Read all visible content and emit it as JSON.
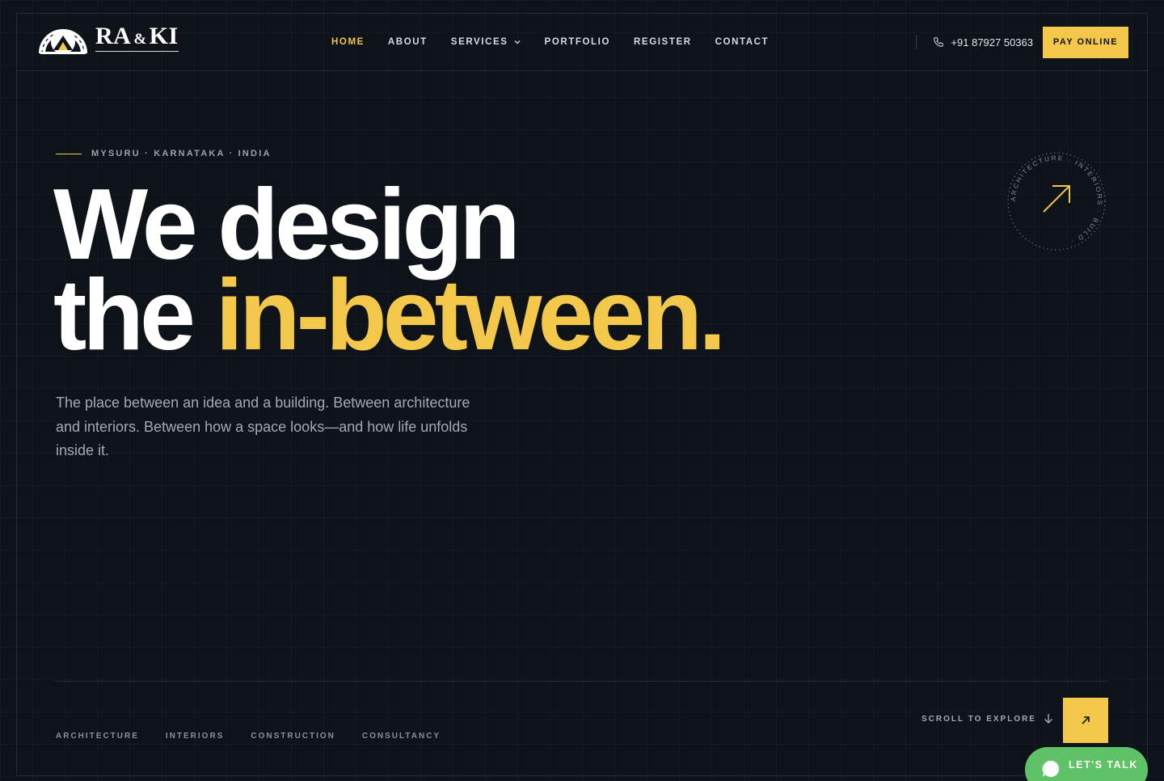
{
  "brand": {
    "name_left": "RA",
    "name_amp": "&",
    "name_right": "KI"
  },
  "nav": {
    "items": [
      {
        "label": "HOME",
        "active": true
      },
      {
        "label": "ABOUT",
        "active": false
      },
      {
        "label": "SERVICES",
        "active": false,
        "has_dropdown": true
      },
      {
        "label": "PORTFOLIO",
        "active": false
      },
      {
        "label": "REGISTER",
        "active": false
      },
      {
        "label": "CONTACT",
        "active": false
      }
    ]
  },
  "header": {
    "phone": "+91 87927 50363",
    "pay_label": "PAY ONLINE"
  },
  "hero": {
    "kicker": "MYSURU · KARNATAKA · INDIA",
    "line1": "We design",
    "line2_plain": "the ",
    "line2_accent": "in-between.",
    "lead": "The place between an idea and a building. Between architecture and interiors. Between how a space looks—and how life unfolds inside it."
  },
  "badge": {
    "ring_text": "ARCHITECTURE · INTERIORS · BUILD ·"
  },
  "footer": {
    "tags": [
      "ARCHITECTURE",
      "INTERIORS",
      "CONSTRUCTION",
      "CONSULTANCY"
    ],
    "scroll_label": "SCROLL TO EXPLORE",
    "talk_label": "LET'S TALK"
  },
  "colors": {
    "background": "#0e1219",
    "accent": "#f3c74a",
    "whatsapp": "#5fc266",
    "text_muted": "#a4aab4"
  },
  "icons": {
    "phone": "phone-icon",
    "chevron": "chevron-down-icon",
    "arrow": "arrow-up-right-icon",
    "scroll": "arrow-down-icon",
    "chat": "chat-bubble-icon"
  }
}
